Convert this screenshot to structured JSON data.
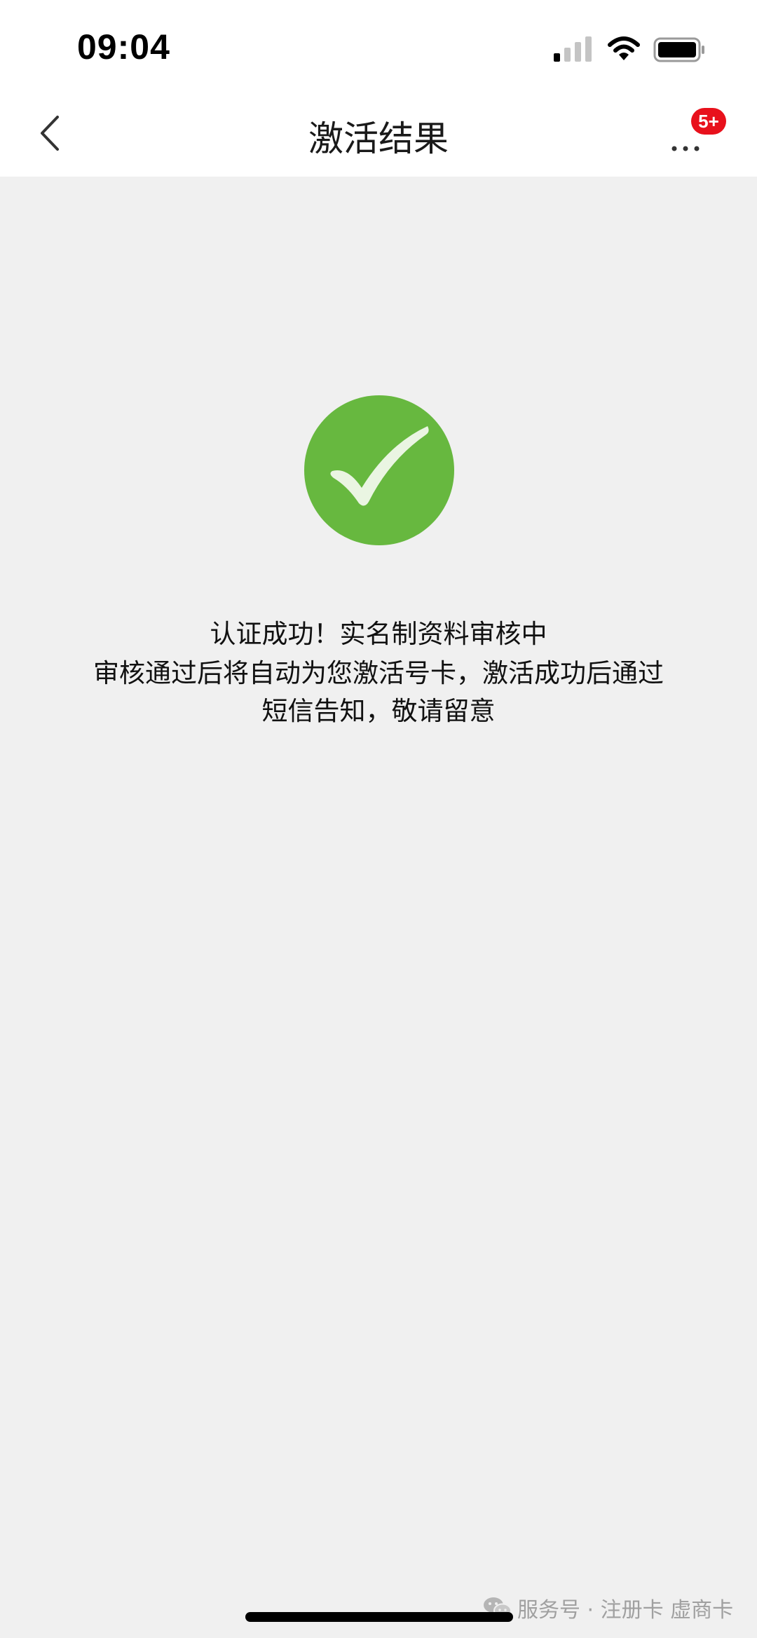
{
  "status_bar": {
    "time": "09:04",
    "signal_icon": "cellular-signal-icon",
    "wifi_icon": "wifi-icon",
    "battery_icon": "battery-icon"
  },
  "nav": {
    "title": "激活结果",
    "back_icon": "chevron-left-icon",
    "more_icon": "more-dots-icon",
    "badge": "5+"
  },
  "result": {
    "icon": "check-circle-icon",
    "icon_color": "#67b83f",
    "line1": "认证成功！实名制资料审核中",
    "line2": "审核通过后将自动为您激活号卡，激活成功后通过",
    "line3": "短信告知，敬请留意"
  },
  "watermark": {
    "icon": "wechat-icon",
    "text": "服务号 · 注册卡 虚商卡"
  }
}
